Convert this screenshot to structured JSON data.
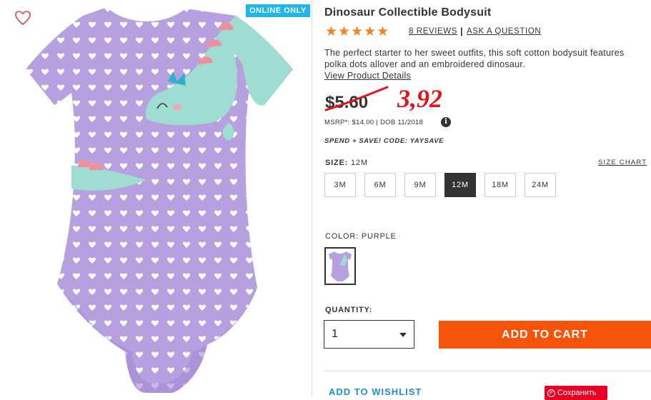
{
  "badge": {
    "online_only": "ONLINE ONLY"
  },
  "product": {
    "title": "Dinosaur Collectible Bodysuit",
    "rating_stars": "★★★★★",
    "rating": 5,
    "reviews_link": "8 REVIEWS",
    "separator": "|",
    "ask_question_link": "ASK A QUESTION",
    "description": "The perfect starter to her sweet outfits, this soft cotton bodysuit features polka dots allover and an embroidered dinosaur.",
    "details_link": "View Product Details",
    "old_price": "$5.60",
    "new_price_annotation": "3,92",
    "msrp": "MSRP*: $14.00 | DOB 11/2018",
    "info_icon": "i",
    "promo": "SPEND + SAVE! CODE: YAYSAVE"
  },
  "size": {
    "label": "SIZE:",
    "selected_value": "12M",
    "chart_link": "SIZE CHART",
    "options": [
      "3M",
      "6M",
      "9M",
      "12M",
      "18M",
      "24M"
    ]
  },
  "color": {
    "label": "COLOR: PURPLE",
    "swatch_icon": "bodysuit-thumbnail"
  },
  "quantity": {
    "label": "QUANTITY:",
    "value": "1"
  },
  "actions": {
    "add_to_cart": "ADD TO CART",
    "add_to_wishlist": "ADD TO WISHLIST",
    "pinterest_save": "Сохранить"
  },
  "colors": {
    "accent_orange": "#f7540b",
    "star_orange": "#f5811f",
    "badge_blue": "#1fb6e8",
    "price_red": "#e3141b",
    "garment_purple": "#b6a0e0",
    "dino_mint": "#9fdcd2",
    "wishlist_blue": "#1a8fd6",
    "pinterest_red": "#e60023"
  }
}
